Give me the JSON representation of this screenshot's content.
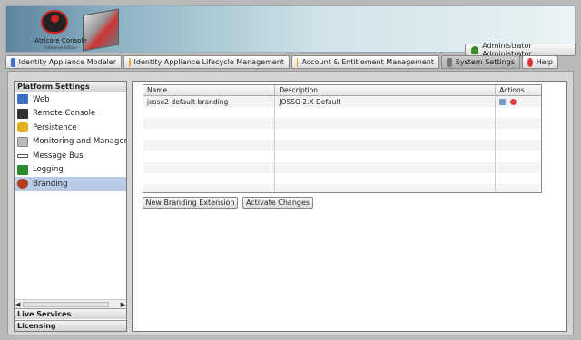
{
  "app": {
    "title": "Atricore Console",
    "subtitle": "Enterprise Edition",
    "user_button": "Administrator Administrator"
  },
  "tabs": [
    {
      "label": "Identity Appliance Modeler",
      "icon": "modeler-icon",
      "active": false
    },
    {
      "label": "Identity Appliance Lifecycle Management",
      "icon": "lifecycle-icon",
      "active": false
    },
    {
      "label": "Account & Entitlement Management",
      "icon": "account-icon",
      "active": false
    },
    {
      "label": "System Settings",
      "icon": "settings-icon",
      "active": true
    },
    {
      "label": "Help",
      "icon": "help-icon",
      "active": false
    }
  ],
  "sidebar": {
    "header": "Platform Settings",
    "items": [
      {
        "label": "Web",
        "icon": "web-icon",
        "color": "#3d6fc4"
      },
      {
        "label": "Remote Console",
        "icon": "console-icon",
        "color": "#333333"
      },
      {
        "label": "Persistence",
        "icon": "database-icon",
        "color": "#e0b020"
      },
      {
        "label": "Monitoring and Management",
        "icon": "monitoring-icon",
        "color": "#999999"
      },
      {
        "label": "Message Bus",
        "icon": "bus-icon",
        "color": "#666666"
      },
      {
        "label": "Logging",
        "icon": "logging-icon",
        "color": "#2e8a2e"
      },
      {
        "label": "Branding",
        "icon": "branding-icon",
        "color": "#b04020",
        "selected": true
      }
    ],
    "footers": [
      "Live Services",
      "Licensing"
    ]
  },
  "grid": {
    "columns": [
      "Name",
      "Description",
      "Actions"
    ],
    "rows": [
      {
        "name": "josso2-default-branding",
        "description": "JOSSO 2.X Default"
      }
    ]
  },
  "buttons": {
    "new_branding": "New Branding Extension",
    "activate": "Activate Changes"
  }
}
